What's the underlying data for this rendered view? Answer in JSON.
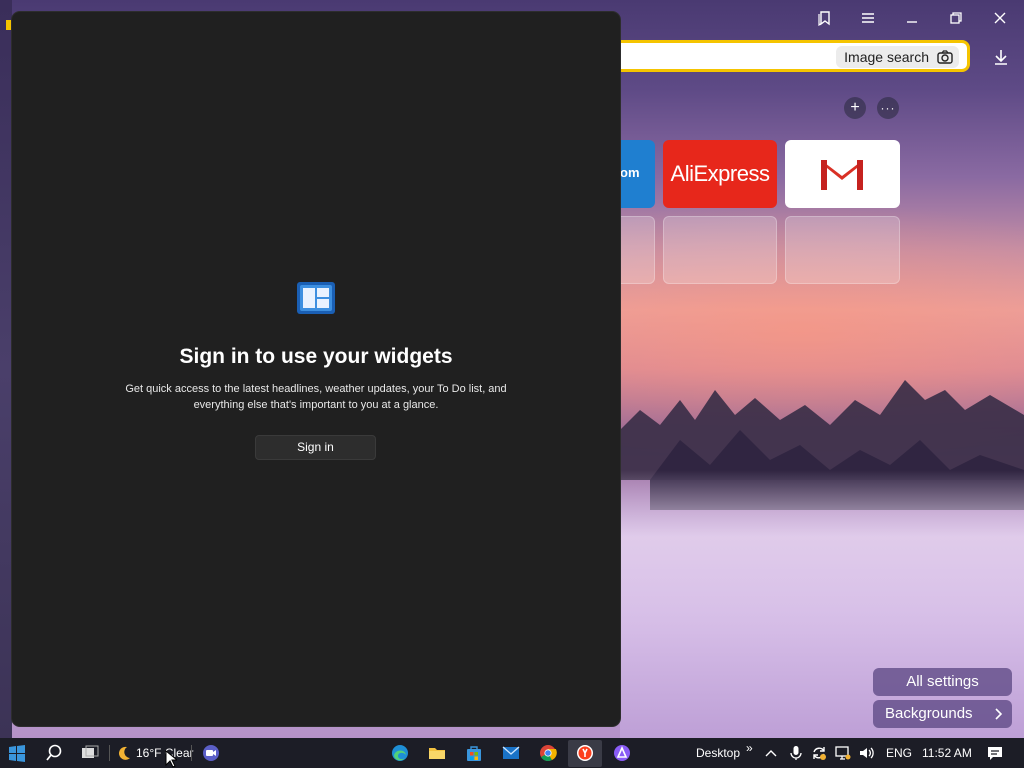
{
  "browser": {
    "omnibox": {
      "image_search_label": "Image search"
    },
    "speed_dial": [
      {
        "label": "om",
        "brand_color": "#1f7fd0"
      },
      {
        "label": "AliExpress",
        "brand_color": "#e7271b"
      },
      {
        "label": "Gmail",
        "brand_color": "#ffffff"
      }
    ],
    "settings": {
      "all_settings_label": "All settings",
      "backgrounds_label": "Backgrounds"
    }
  },
  "widgets_panel": {
    "title": "Sign in to use your widgets",
    "description": "Get quick access to the latest headlines, weather updates, your To Do list, and everything else that's important to you at a glance.",
    "sign_in_label": "Sign in"
  },
  "taskbar": {
    "weather": "16°F Clear",
    "desktop_label": "Desktop",
    "language": "ENG",
    "time": "11:52 AM"
  },
  "colors": {
    "accent_yellow": "#f5c400",
    "panel_bg": "#202020",
    "taskbar_bg": "#1c1d26"
  }
}
